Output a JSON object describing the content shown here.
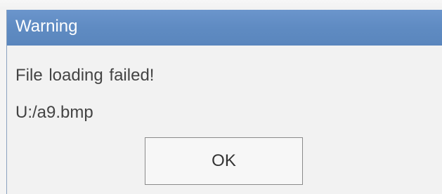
{
  "dialog": {
    "title": "Warning",
    "message": "File loading failed!",
    "path": "U:/a9.bmp",
    "ok_label": "OK"
  },
  "colors": {
    "titlebar": "#5f8bc2",
    "title_text": "#ffffff",
    "content_bg": "#f2f2f2",
    "button_border": "#8a8a8a"
  }
}
